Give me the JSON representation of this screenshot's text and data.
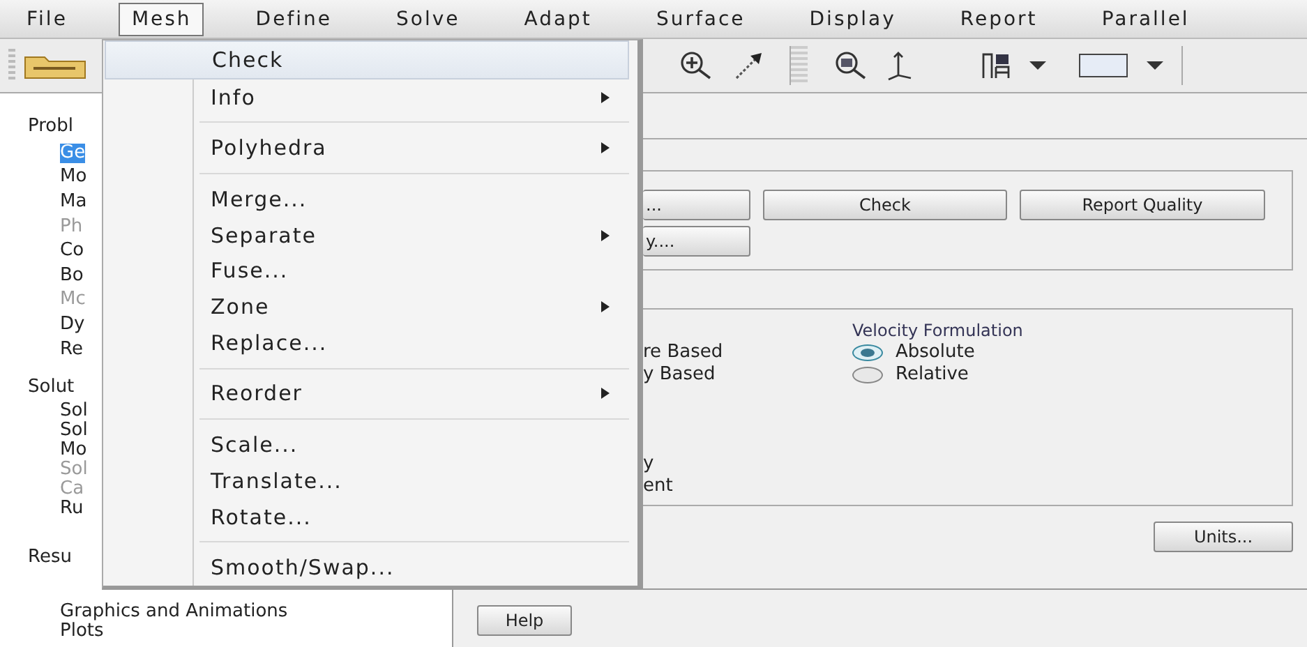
{
  "menu_bar": [
    {
      "label": "File",
      "selected": false
    },
    {
      "label": "Mesh",
      "selected": true
    },
    {
      "label": "Define",
      "selected": false
    },
    {
      "label": "Solve",
      "selected": false
    },
    {
      "label": "Adapt",
      "selected": false
    },
    {
      "label": "Surface",
      "selected": false
    },
    {
      "label": "Display",
      "selected": false
    },
    {
      "label": "Report",
      "selected": false
    },
    {
      "label": "Parallel",
      "selected": false
    }
  ],
  "tree": [
    {
      "label": "Probl",
      "children": [
        {
          "label": "Ge",
          "selected": true,
          "disabled": false
        },
        {
          "label": "Mo",
          "selected": false,
          "disabled": false
        },
        {
          "label": "Ma",
          "selected": false,
          "disabled": false
        },
        {
          "label": "Ph",
          "selected": false,
          "disabled": true
        },
        {
          "label": "Co",
          "selected": false,
          "disabled": false
        },
        {
          "label": "Bo",
          "selected": false,
          "disabled": false
        },
        {
          "label": "Mc",
          "selected": false,
          "disabled": true
        },
        {
          "label": "Dy",
          "selected": false,
          "disabled": false
        },
        {
          "label": "Re",
          "selected": false,
          "disabled": false
        }
      ]
    },
    {
      "label": "Solut",
      "children": [
        {
          "label": "Sol",
          "selected": false,
          "disabled": false
        },
        {
          "label": "Sol",
          "selected": false,
          "disabled": false
        },
        {
          "label": "Mo",
          "selected": false,
          "disabled": false
        },
        {
          "label": "Sol",
          "selected": false,
          "disabled": true
        },
        {
          "label": "Ca",
          "selected": false,
          "disabled": true
        },
        {
          "label": "Ru",
          "selected": false,
          "disabled": false
        }
      ]
    },
    {
      "label": "Resu",
      "children": [
        {
          "label": "Graphics and Animations",
          "selected": false,
          "disabled": false
        },
        {
          "label": "Plots",
          "selected": false,
          "disabled": false
        }
      ]
    }
  ],
  "mesh_menu": [
    {
      "kind": "item",
      "label": "Check",
      "highlighted": true,
      "submenu": false
    },
    {
      "kind": "item",
      "label": "Info",
      "highlighted": false,
      "submenu": true
    },
    {
      "kind": "separator"
    },
    {
      "kind": "item",
      "label": "Polyhedra",
      "highlighted": false,
      "submenu": true
    },
    {
      "kind": "separator"
    },
    {
      "kind": "item",
      "label": "Merge...",
      "highlighted": false,
      "submenu": false
    },
    {
      "kind": "item",
      "label": "Separate",
      "highlighted": false,
      "submenu": true
    },
    {
      "kind": "item",
      "label": "Fuse...",
      "highlighted": false,
      "submenu": false
    },
    {
      "kind": "item",
      "label": "Zone",
      "highlighted": false,
      "submenu": true
    },
    {
      "kind": "item",
      "label": "Replace...",
      "highlighted": false,
      "submenu": false
    },
    {
      "kind": "separator"
    },
    {
      "kind": "item",
      "label": "Reorder",
      "highlighted": false,
      "submenu": true
    },
    {
      "kind": "separator"
    },
    {
      "kind": "item",
      "label": "Scale...",
      "highlighted": false,
      "submenu": false
    },
    {
      "kind": "item",
      "label": "Translate...",
      "highlighted": false,
      "submenu": false
    },
    {
      "kind": "item",
      "label": "Rotate...",
      "highlighted": false,
      "submenu": false
    },
    {
      "kind": "separator"
    },
    {
      "kind": "item",
      "label": "Smooth/Swap...",
      "highlighted": false,
      "submenu": false
    }
  ],
  "mesh_group": {
    "buttons_row_1": [
      "...",
      "Check",
      "Report Quality"
    ],
    "buttons_row_2": [
      "y...."
    ]
  },
  "solver_group": {
    "type_options": [
      "re Based",
      "y Based"
    ],
    "velocity_formulation": {
      "title": "Velocity Formulation",
      "options": [
        {
          "label": "Absolute",
          "selected": true
        },
        {
          "label": "Relative",
          "selected": false
        }
      ]
    },
    "time_options": [
      "y",
      "ent"
    ]
  },
  "units_button": "Units...",
  "help_button": "Help"
}
